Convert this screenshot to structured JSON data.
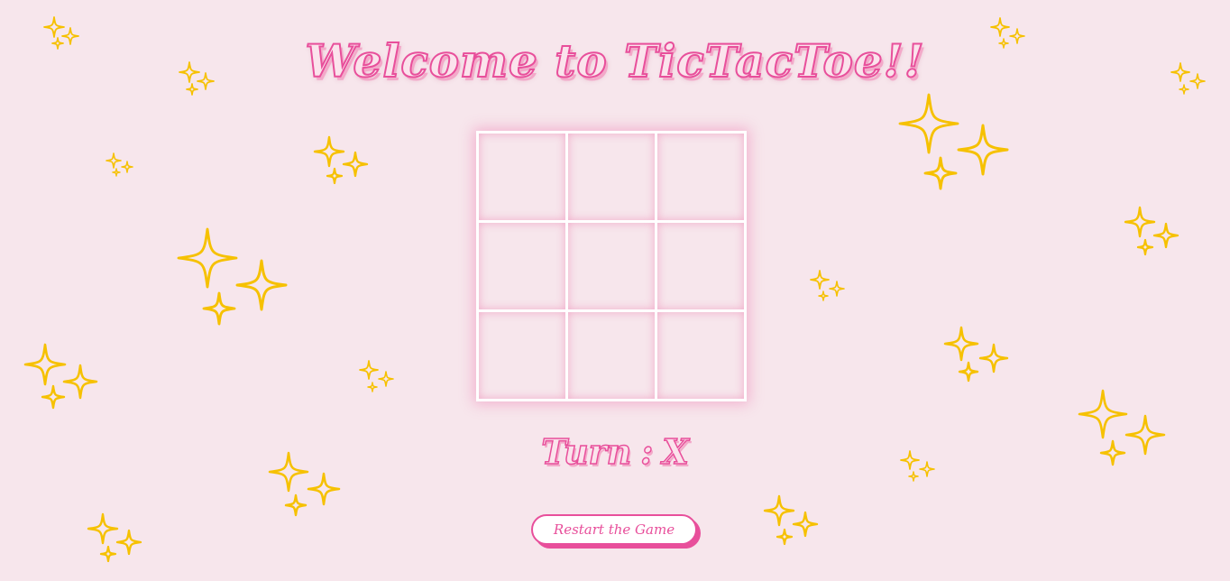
{
  "title": "Welcome to TicTacToe!!",
  "board": {
    "cells": [
      "",
      "",
      "",
      "",
      "",
      "",
      "",
      "",
      ""
    ]
  },
  "turn": {
    "label": "Turn",
    "separator": ":",
    "player": "X"
  },
  "restart_button": {
    "label": "Restart the Game"
  },
  "colors": {
    "background": "#f7e6ec",
    "accent_pink": "#e84f9b",
    "sparkle_yellow": "#f6c100",
    "grid_lines": "#ffffff"
  },
  "icons": {
    "decoration": "sparkle-icon"
  }
}
